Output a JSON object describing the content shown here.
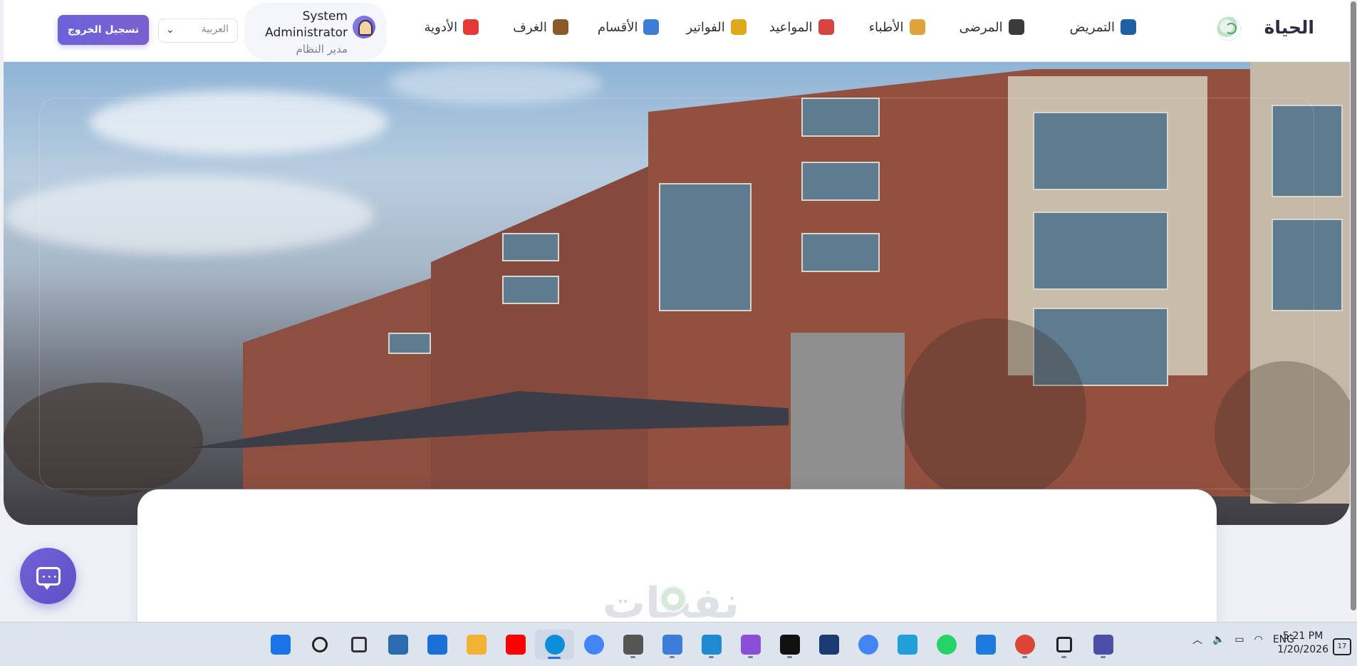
{
  "header": {
    "brand": "الحياة",
    "nav": [
      {
        "label": "التمريض",
        "icon": "stethoscope-icon",
        "color": "#1f5fa8"
      },
      {
        "label": "المرضى",
        "icon": "patients-icon",
        "color": "#3b3b3b"
      },
      {
        "label": "الأطباء",
        "icon": "doctor-icon",
        "color": "#e2a23b"
      },
      {
        "label": "المواعيد",
        "icon": "calendar-icon",
        "color": "#d64541"
      },
      {
        "label": "الفواتير",
        "icon": "money-bag-icon",
        "color": "#e0a81b"
      },
      {
        "label": "الأقسام",
        "icon": "hospital-icon",
        "color": "#3b7dd8"
      },
      {
        "label": "الغرف",
        "icon": "door-icon",
        "color": "#8a5a2b"
      },
      {
        "label": "الأدوية",
        "icon": "pill-icon",
        "color": "#e53935"
      }
    ],
    "user": {
      "name": "System Administrator",
      "role": "مدير النظام"
    },
    "language": "العربية",
    "logout_label": "تسجيل الخروج"
  },
  "card": {
    "watermark": "نفحات"
  },
  "taskbar": {
    "apps": [
      {
        "name": "windows-start-icon",
        "color": "#1a73e8"
      },
      {
        "name": "search-icon",
        "color": "#222222"
      },
      {
        "name": "task-view-icon",
        "color": "#333333"
      },
      {
        "name": "widgets-icon",
        "color": "#2b6cb0"
      },
      {
        "name": "store-icon",
        "color": "#1c6fd6"
      },
      {
        "name": "file-explorer-icon",
        "color": "#f2b233"
      },
      {
        "name": "youtube-icon",
        "color": "#ff0000"
      },
      {
        "name": "edge-icon",
        "color": "#0c8fd8"
      },
      {
        "name": "chrome-icon",
        "color": "#4285f4"
      },
      {
        "name": "github-desktop-icon",
        "color": "#555555"
      },
      {
        "name": "vpn-icon",
        "color": "#3b7dd8"
      },
      {
        "name": "vscode-icon",
        "color": "#1f8ad2"
      },
      {
        "name": "visual-studio-icon",
        "color": "#8a4fd6"
      },
      {
        "name": "cursor-app-icon",
        "color": "#111111"
      },
      {
        "name": "arch-app-icon",
        "color": "#1d3b73"
      },
      {
        "name": "google-cloud-icon",
        "color": "#4285f4"
      },
      {
        "name": "telegram-icon",
        "color": "#229ed9"
      },
      {
        "name": "whatsapp-icon",
        "color": "#25d366"
      },
      {
        "name": "mail-icon",
        "color": "#1f7ae0"
      },
      {
        "name": "chrome-profile-icon",
        "color": "#db4437"
      },
      {
        "name": "chatgpt-icon",
        "color": "#222222"
      },
      {
        "name": "terminal-icon",
        "color": "#4b4fa8"
      }
    ],
    "tray": {
      "language": "ENG"
    },
    "clock": {
      "time": "5:21 PM",
      "date": "1/20/2026"
    },
    "notifications": "17"
  }
}
